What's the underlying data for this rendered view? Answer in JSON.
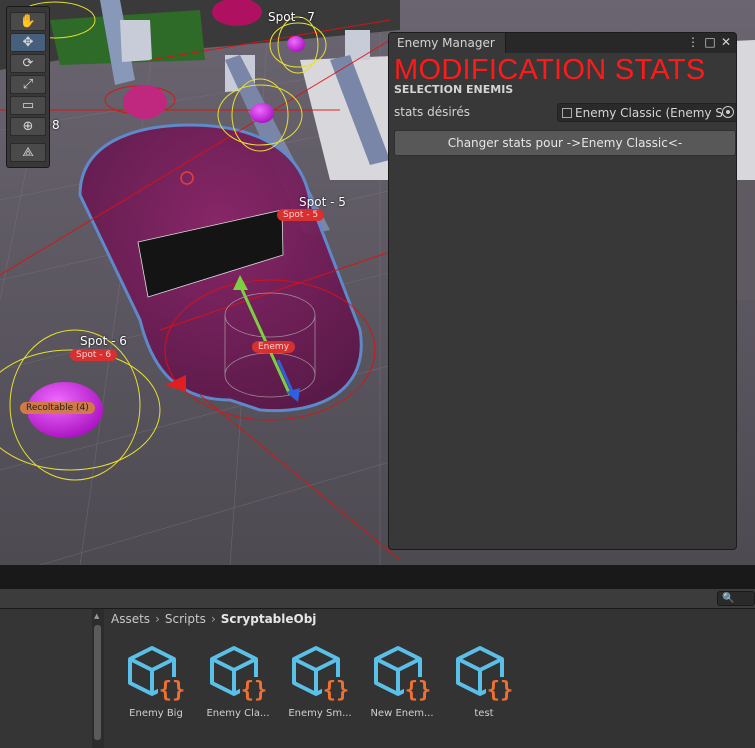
{
  "scene": {
    "spot_labels": [
      "Spot - 7",
      "Spot - 5",
      "Spot - 6"
    ],
    "pill_labels": [
      "Spot - 5",
      "Spot - 6",
      "Enemy",
      "Recoltable (4)"
    ],
    "side_number": "8"
  },
  "toolbar": {
    "tools": [
      "hand-tool",
      "move-tool",
      "rotate-tool",
      "scale-tool",
      "rect-tool",
      "transform-tool",
      "custom-tool"
    ],
    "active": "move-tool"
  },
  "enemy_manager": {
    "tab_title": "Enemy Manager",
    "heading": "MODIFICATION STATS",
    "section": "SELECTION ENEMIS",
    "stats_label": "stats désirés",
    "stats_value": "Enemy Classic (Enemy S",
    "change_button": "Changer stats pour ->Enemy Classic<-"
  },
  "project": {
    "breadcrumb": [
      "Assets",
      "Scripts"
    ],
    "breadcrumb_current": "ScryptableObj",
    "assets": [
      {
        "label": "Enemy Big"
      },
      {
        "label": "Enemy Cla..."
      },
      {
        "label": "Enemy Sm..."
      },
      {
        "label": "New Enem..."
      },
      {
        "label": "test"
      }
    ]
  },
  "colors": {
    "heading": "#ff1a1a",
    "asset_cube": "#5bc0e8",
    "asset_braces": "#f07030"
  }
}
